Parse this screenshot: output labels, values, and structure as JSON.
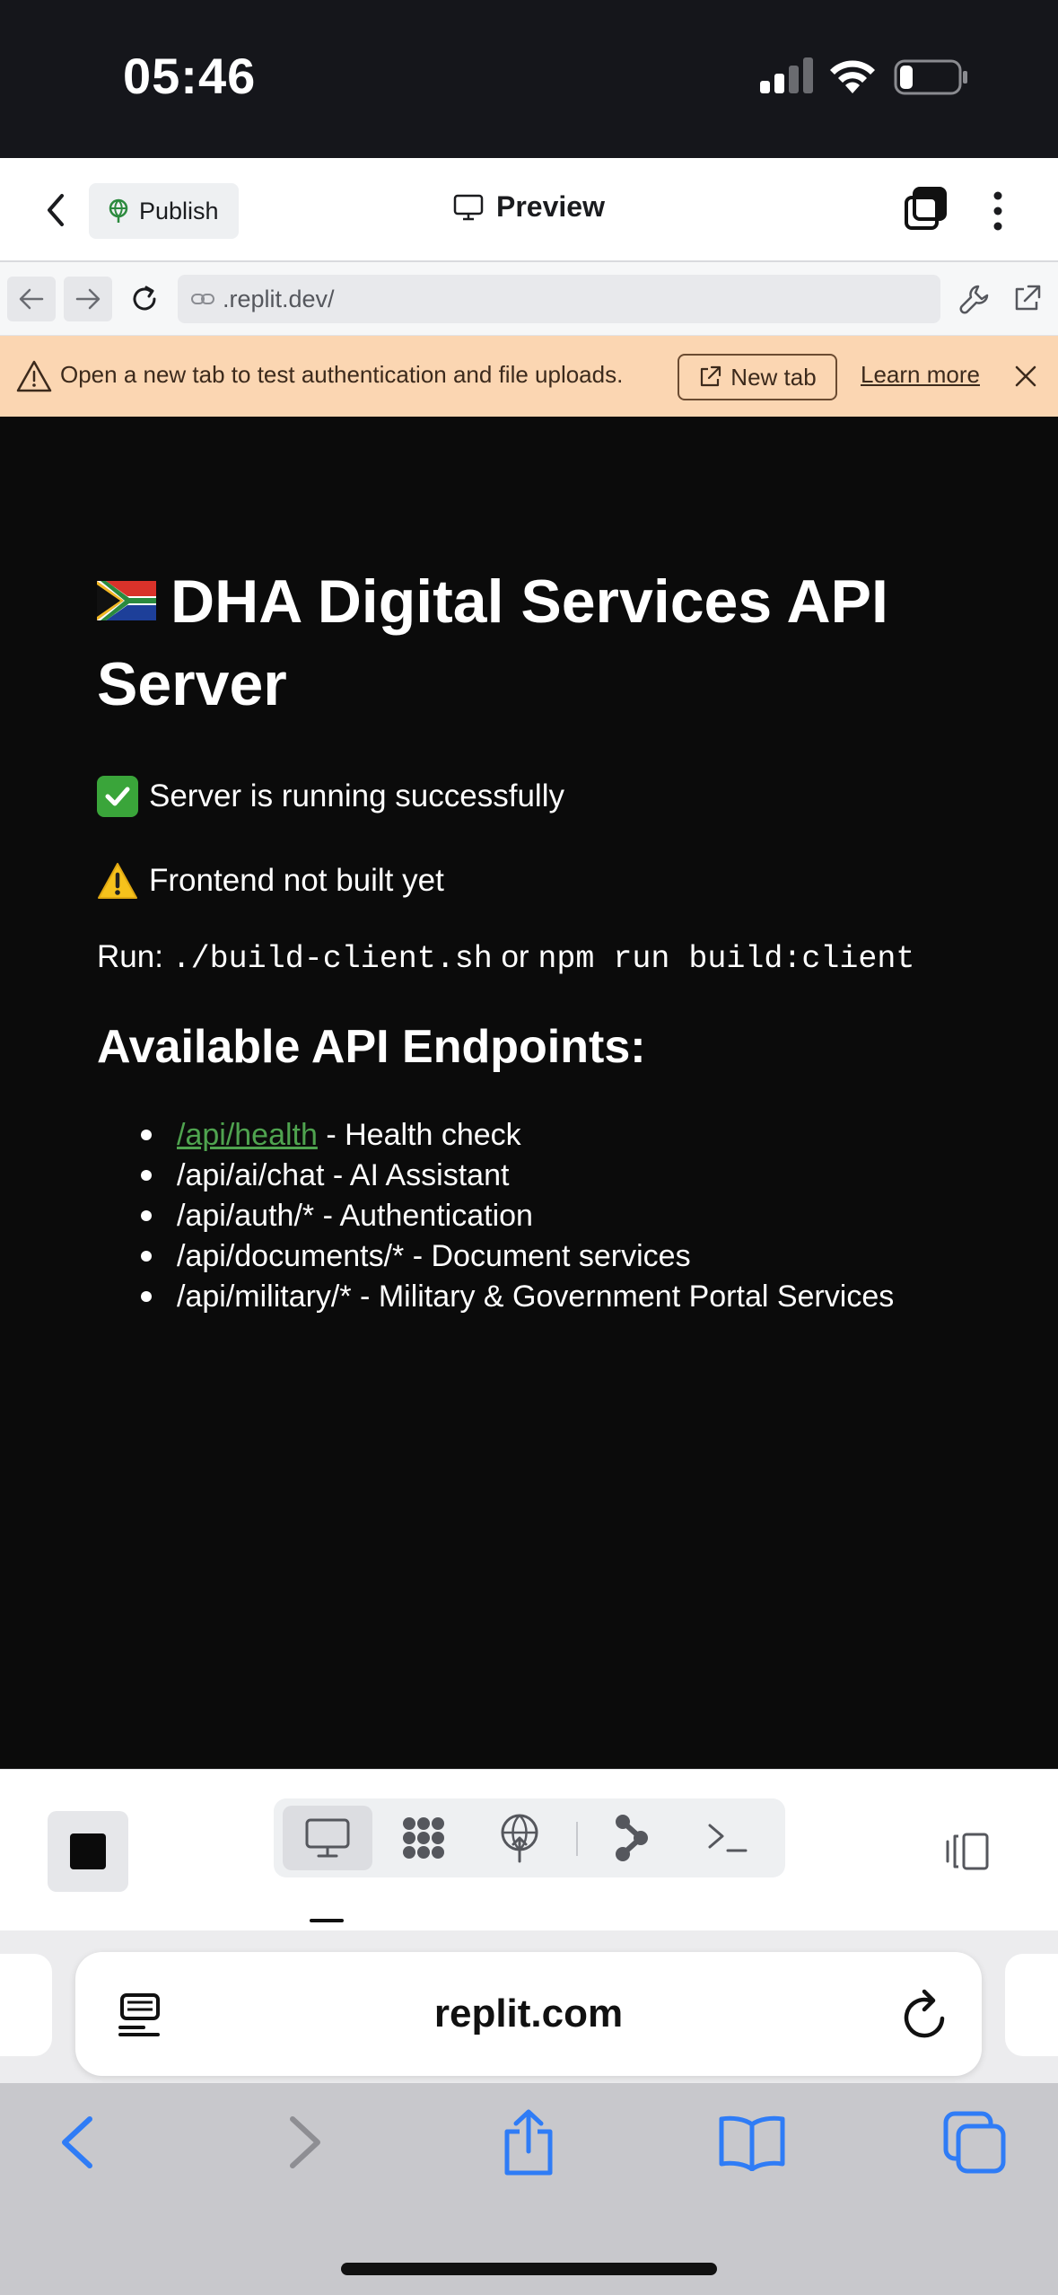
{
  "status_bar": {
    "time": "05:46"
  },
  "header": {
    "publish_label": "Publish",
    "title": "Preview"
  },
  "url_bar": {
    "url": ".replit.dev/"
  },
  "banner": {
    "message": "Open a new tab to test authentication and file uploads.",
    "new_tab_label": "New tab",
    "learn_more_label": "Learn more"
  },
  "page": {
    "title": "DHA Digital Services API Server",
    "server_status": "Server is running successfully",
    "frontend_status": "Frontend not built yet",
    "run_prefix": "Run:",
    "run_command_1": "./build-client.sh",
    "run_or": "or",
    "run_command_2": "npm run build:client",
    "endpoints_heading": "Available API Endpoints:",
    "endpoints": [
      {
        "path": "/api/health",
        "desc": " - Health check"
      },
      {
        "path": "/api/ai/chat",
        "desc": " - AI Assistant"
      },
      {
        "path": "/api/auth/*",
        "desc": " - Authentication"
      },
      {
        "path": "/api/documents/*",
        "desc": " - Document services"
      },
      {
        "path": "/api/military/*",
        "desc": " - Military & Government Portal Services"
      }
    ]
  },
  "safari": {
    "address": "replit.com"
  },
  "colors": {
    "banner_bg": "#fbd6b2",
    "link_green": "#4fa34f",
    "safari_blue": "#2f7cf6"
  }
}
